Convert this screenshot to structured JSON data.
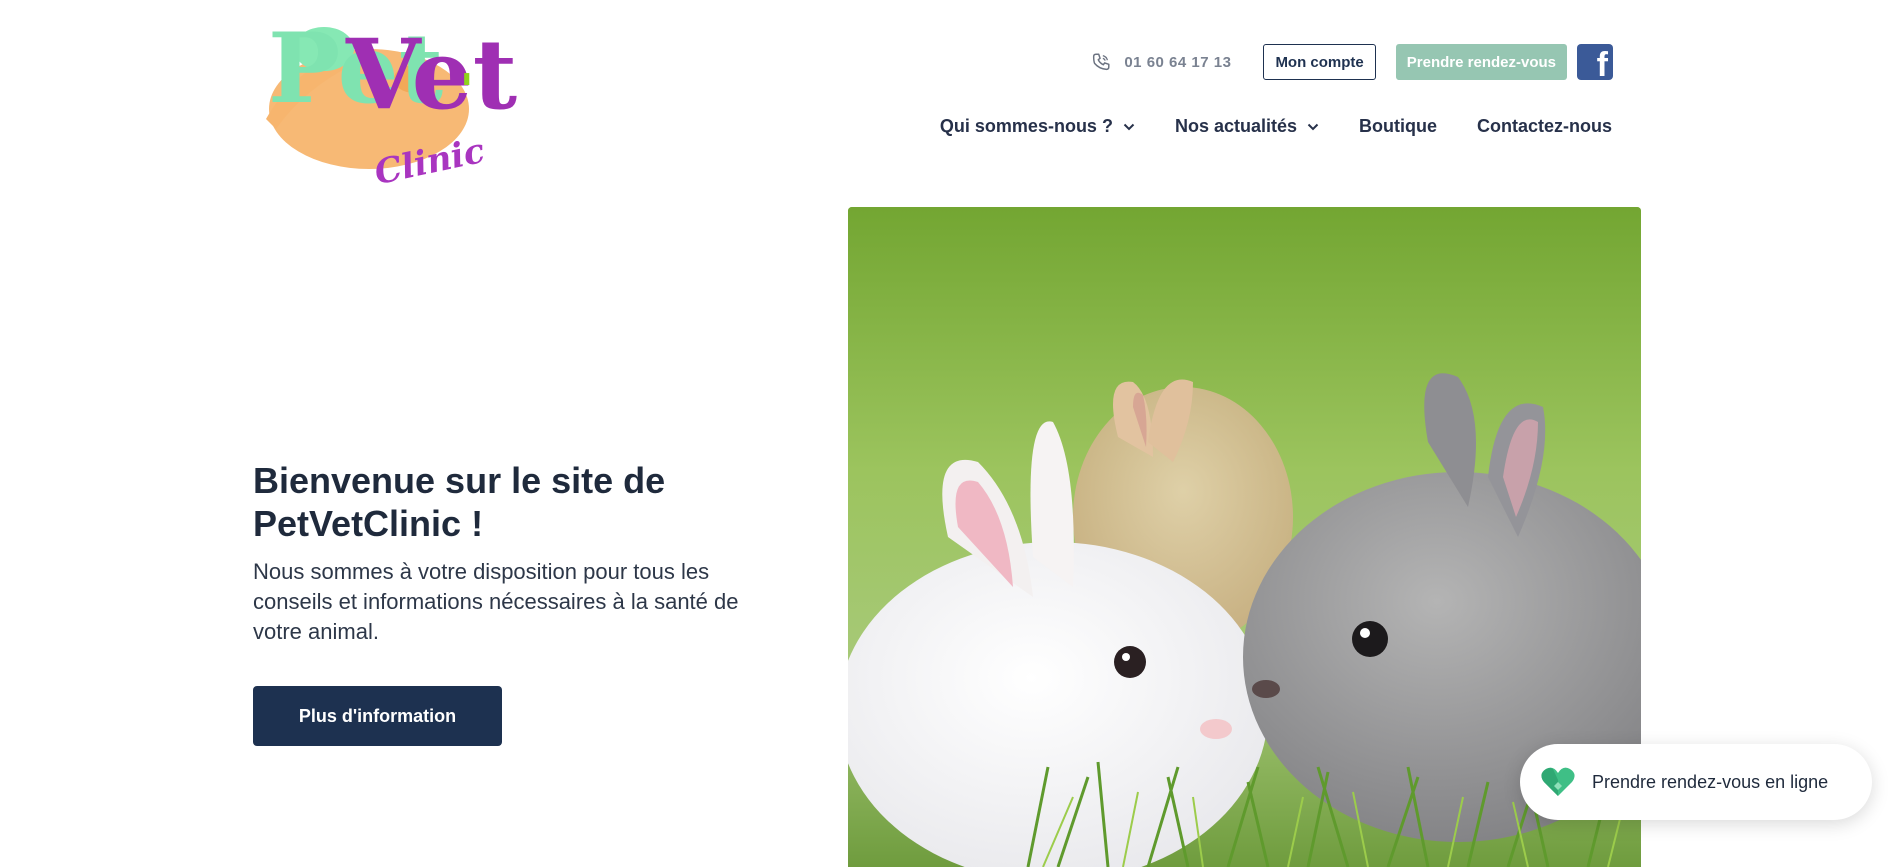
{
  "brand": {
    "logo_alt": "PetVet' Clinic",
    "logo_pet": "Pet",
    "logo_vet": "Vet",
    "logo_apos": "'",
    "logo_clinic": "Clinic",
    "colors": {
      "pet": "#7fe3b0",
      "vet": "#b43fc2",
      "et": "#c13bd4",
      "accent": "#f4b36b",
      "apos": "#8fd41b"
    }
  },
  "topbar": {
    "phone_icon": "phone-icon",
    "phone": "01 60 64 17 13",
    "account_label": "Mon compte",
    "appointment_label": "Prendre rendez-vous",
    "facebook_icon": "facebook-icon"
  },
  "nav": {
    "items": [
      {
        "label": "Qui sommes-nous ?",
        "has_dropdown": true
      },
      {
        "label": "Nos actualités",
        "has_dropdown": true
      },
      {
        "label": "Boutique",
        "has_dropdown": false
      },
      {
        "label": "Contactez-nous",
        "has_dropdown": false
      }
    ]
  },
  "hero": {
    "title": "Bienvenue sur le site de PetVetClinic !",
    "subtitle": "Nous sommes à votre disposition pour tous les conseils et informations nécessaires à la santé de votre animal.",
    "button_label": "Plus d'information",
    "image_alt": "rabbits-photo"
  },
  "widget": {
    "icon": "heart-icon",
    "label": "Prendre rendez-vous en ligne"
  },
  "colors": {
    "primary": "#1d3150",
    "appointment": "#96c6b2",
    "facebook": "#3b5a98",
    "widget_heart": "#3fbf86"
  }
}
